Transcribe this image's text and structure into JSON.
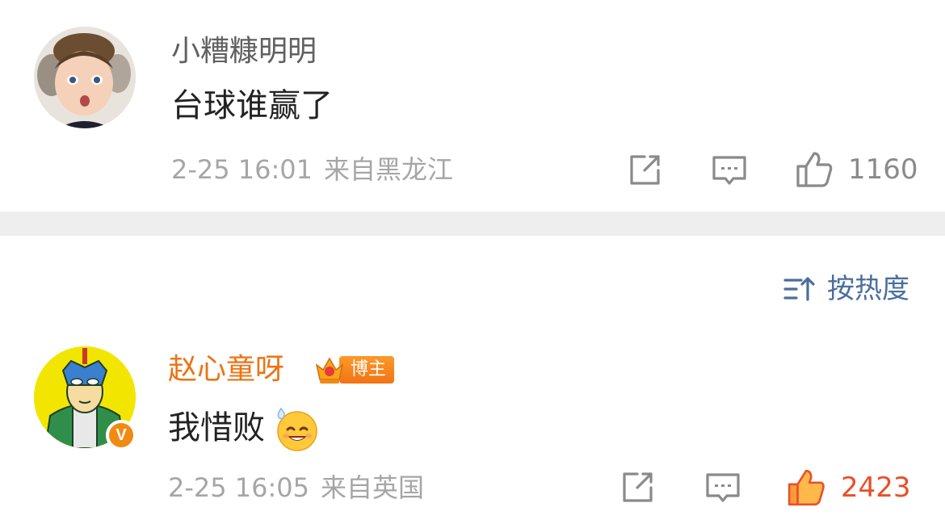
{
  "comments": [
    {
      "username": "小糟糠明明",
      "content": "台球谁赢了",
      "time": "2-25 16:01",
      "source": "来自黑龙江",
      "likes": "1160",
      "liked": false
    },
    {
      "username": "赵心童呀",
      "badge": "博主",
      "content": "我惜败",
      "emoji": "smiling-sweat-emoji",
      "time": "2-25 16:05",
      "source": "来自英国",
      "likes": "2423",
      "liked": true,
      "verified_mark": "V"
    }
  ],
  "sort": {
    "label": "按热度",
    "icon": "sort-icon"
  },
  "colors": {
    "username_default": "#606060",
    "username_highlight": "#eb7314",
    "like_active": "#e8502a",
    "sort_text": "#4a6f9c",
    "divider": "#eeeeee"
  }
}
